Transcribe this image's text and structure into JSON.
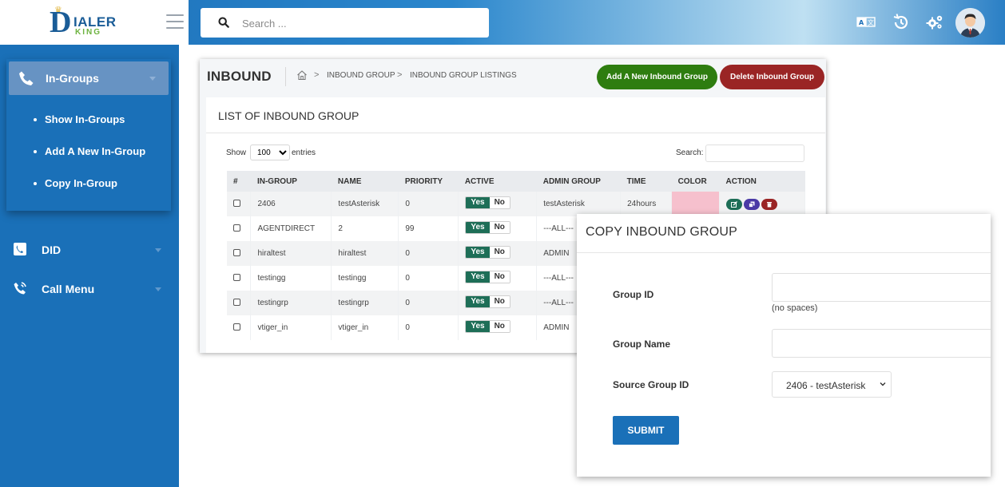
{
  "header": {
    "logo": {
      "letter": "D",
      "brand": "IALER",
      "sub": "KING"
    },
    "search": {
      "placeholder": "Search ..."
    },
    "icons": [
      "translate-icon",
      "history-icon",
      "settings-gears-icon",
      "user-avatar"
    ]
  },
  "sidebar": {
    "expanded": {
      "label": "In-Groups",
      "icon": "phone-icon",
      "items": [
        {
          "label": "Show In-Groups"
        },
        {
          "label": "Add A New In-Group"
        },
        {
          "label": "Copy In-Group"
        }
      ]
    },
    "items": [
      {
        "label": "DID",
        "icon": "phone-book-icon"
      },
      {
        "label": "Call Menu",
        "icon": "phone-ring-icon"
      }
    ]
  },
  "page": {
    "title": "INBOUND",
    "breadcrumb": [
      "INBOUND GROUP",
      "INBOUND GROUP LISTINGS"
    ],
    "buttons": {
      "add": "Add A New Inbound Group",
      "delete": "Delete Inbound Group"
    },
    "list_title": "LIST OF INBOUND GROUP",
    "show_label": "Show",
    "show_value": "100",
    "entries_label": "entries",
    "search_label": "Search:",
    "table": {
      "columns": [
        "#",
        "IN-GROUP",
        "NAME",
        "PRIORITY",
        "ACTIVE",
        "ADMIN GROUP",
        "TIME",
        "COLOR",
        "ACTION"
      ],
      "toggle": {
        "yes": "Yes",
        "no": "No"
      },
      "rows": [
        {
          "ingroup": "2406",
          "name": "testAsterisk",
          "priority": "0",
          "admin": "testAsterisk",
          "time": "24hours"
        },
        {
          "ingroup": "AGENTDIRECT",
          "name": "2",
          "priority": "99",
          "admin": "---ALL---",
          "time": ""
        },
        {
          "ingroup": "hiraltest",
          "name": "hiraltest",
          "priority": "0",
          "admin": "ADMIN",
          "time": ""
        },
        {
          "ingroup": "testingg",
          "name": "testingg",
          "priority": "0",
          "admin": "---ALL---",
          "time": ""
        },
        {
          "ingroup": "testingrp",
          "name": "testingrp",
          "priority": "0",
          "admin": "---ALL---",
          "time": ""
        },
        {
          "ingroup": "vtiger_in",
          "name": "vtiger_in",
          "priority": "0",
          "admin": "ADMIN",
          "time": ""
        }
      ]
    }
  },
  "modal": {
    "title": "COPY INBOUND GROUP",
    "group_id_label": "Group ID",
    "group_id_value": "",
    "group_id_hint": "(no spaces)",
    "group_name_label": "Group Name",
    "group_name_value": "",
    "source_label": "Source Group ID",
    "source_value": "2406 - testAsterisk",
    "submit": "SUBMIT"
  },
  "colors": {
    "primary": "#1a70b8",
    "green": "#2e7d10",
    "red": "#9a2525",
    "toggle_yes": "#1e6e57",
    "row_color": "#f6c0cd"
  }
}
